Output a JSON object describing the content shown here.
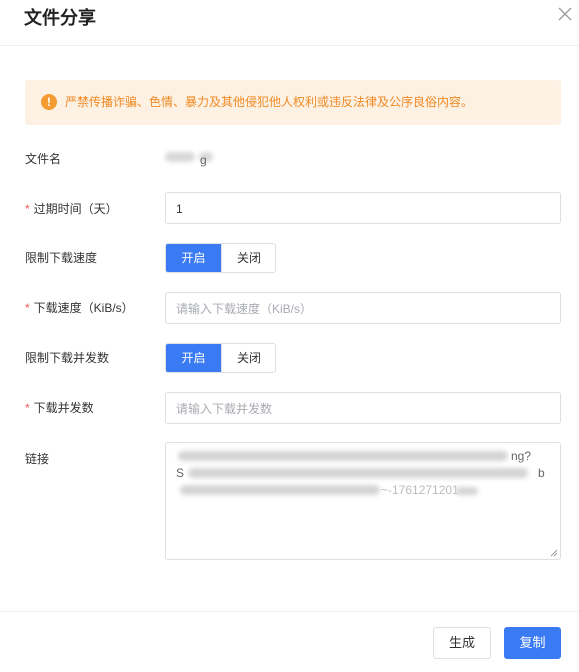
{
  "dialog": {
    "title": "文件分享",
    "close_icon": "close-icon"
  },
  "alert": {
    "icon": "exclamation-icon",
    "text": "严禁传播诈骗、色情、暴力及其他侵犯他人权利或违反法律及公序良俗内容。"
  },
  "form": {
    "filename": {
      "label": "文件名",
      "value_visible_fragment": "g"
    },
    "expire": {
      "required_mark": "*",
      "label": "过期时间（天）",
      "value": "1"
    },
    "limit_speed": {
      "label": "限制下载速度",
      "on_label": "开启",
      "off_label": "关闭",
      "selected": "开启"
    },
    "speed": {
      "required_mark": "*",
      "label": "下载速度（KiB/s）",
      "placeholder": "请输入下载速度（KiB/s）"
    },
    "limit_concurrency": {
      "label": "限制下载并发数",
      "on_label": "开启",
      "off_label": "关闭",
      "selected": "开启"
    },
    "concurrency": {
      "required_mark": "*",
      "label": "下载并发数",
      "placeholder": "请输入下载并发数"
    },
    "link": {
      "label": "链接",
      "visible_fragments": [
        "ng?",
        "S",
        "b",
        "~-1761271201"
      ]
    }
  },
  "footer": {
    "generate_label": "生成",
    "copy_label": "复制"
  },
  "colors": {
    "primary": "#3a7af3",
    "warning_bg": "#fdf1e3",
    "warning_text": "#f08a24",
    "required": "#f25858"
  }
}
